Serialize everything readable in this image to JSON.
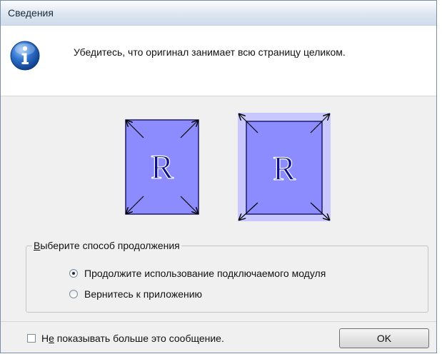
{
  "dialog": {
    "title": "Сведения",
    "message": "Убедитесь, что оригинал занимает всю страницу целиком.",
    "icon": "info-icon",
    "illustration_letter": "R",
    "colors": {
      "page_fill": "#8c8cff",
      "page_halo": "#c8c8ff",
      "title_gradient_bottom": "#d0dceb"
    }
  },
  "group": {
    "legend": "Выберите способ продолжения",
    "legend_mnemonic": "В",
    "options": [
      {
        "label": "Продолжите использование подключаемого модуля",
        "selected": true
      },
      {
        "label": "Вернитесь к приложению",
        "selected": false
      }
    ]
  },
  "footer": {
    "checkbox_mnemonic": "е",
    "checkbox_label_prefix": "Н",
    "checkbox_label_rest": " показывать больше это сообщение.",
    "checkbox_checked": false,
    "ok_label": "OK"
  }
}
